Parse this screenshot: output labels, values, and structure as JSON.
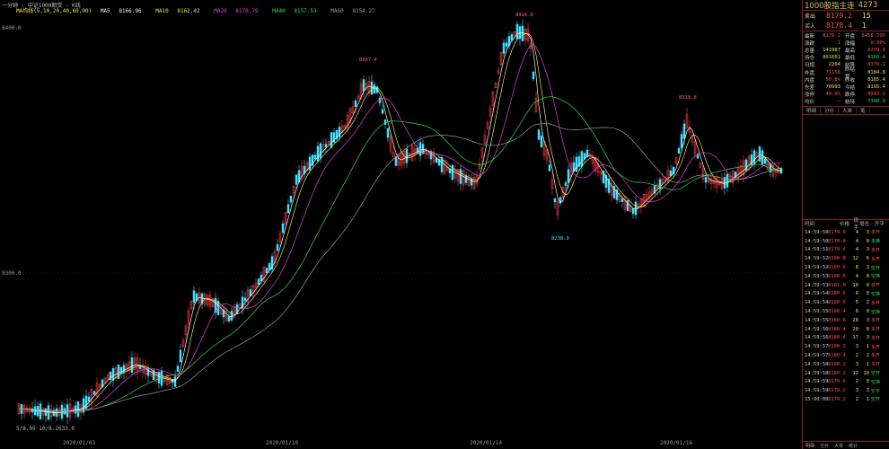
{
  "header": {
    "title": "一分钟 - 中证1000期货 - K线",
    "ma_label": "MA均线(5,10,20,40,60,90)",
    "ma": [
      {
        "label": "MA5",
        "value": "8166.96",
        "color": "#f0f0f0"
      },
      {
        "label": "MA10",
        "value": "8162.42",
        "color": "#e8e05a"
      },
      {
        "label": "MA20",
        "value": "8170.79",
        "color": "#e040e0"
      },
      {
        "label": "MA40",
        "value": "8157.53",
        "color": "#2adf4a"
      },
      {
        "label": "MA60",
        "value": "8154.27",
        "color": "#9a9a9a"
      }
    ]
  },
  "axis": {
    "y_ticks": [
      {
        "label": "8400.0"
      },
      {
        "label": "8300.0"
      }
    ],
    "x_ticks": [
      {
        "label": "2020/01/03"
      },
      {
        "label": "2020/01/10"
      },
      {
        "label": "2020/01/14"
      },
      {
        "label": "2020/01/16"
      }
    ],
    "bottom_left": "5/8.95 10/8.2633.0"
  },
  "markers": [
    {
      "label": "8367.4",
      "kind": "hi"
    },
    {
      "label": "8416.8",
      "kind": "hi"
    },
    {
      "label": "8238.0",
      "kind": "lo"
    },
    {
      "label": "8318.8",
      "kind": "hi"
    }
  ],
  "panel": {
    "title": "1000股指主连",
    "code": "4273",
    "ask": {
      "label": "卖出",
      "price": "8179.2",
      "vol": "15"
    },
    "bid": {
      "label": "买入",
      "price": "8178.4",
      "vol": "1"
    },
    "quote_rows": [
      {
        "k": "最新",
        "v": "8179.2",
        "vc": "#ff4a4a",
        "k2": "开盘",
        "v2": "8458.795",
        "v2c": "#ff4a4a"
      },
      {
        "k": "涨跌",
        "v": "1",
        "vc": "#ff4a4a",
        "k2": "涨幅",
        "v2": "0.00%",
        "v2c": "#ff4a4a"
      },
      {
        "k": "总量",
        "v": "141987",
        "vc": "#e8e05a",
        "k2": "最高",
        "v2": "8299.8",
        "v2c": "#ff4a4a"
      },
      {
        "k": "持仓",
        "v": "801661",
        "vc": "#e8e05a",
        "k2": "最低",
        "v2": "8166.4",
        "v2c": "#2adf4a"
      },
      {
        "k": "日增",
        "v": "2264",
        "vc": "#e8e05a",
        "k2": "结算",
        "v2": "8176.1",
        "v2c": "#ff4a4a"
      },
      {
        "k": "外盘",
        "v": "71156",
        "vc": "#ff4a4a",
        "k2": "昨结算",
        "v2": "8184.8",
        "v2c": "#e8e05a"
      },
      {
        "k": "内盘",
        "v": "50.8%",
        "vc": "#ff4a4a",
        "k2": "昨收",
        "v2": "8185.4",
        "v2c": "#e8e05a"
      },
      {
        "k": "仓差",
        "v": "70993",
        "vc": "#e8e05a",
        "k2": "今结",
        "v2": "8195.4",
        "v2c": "#e8e05a"
      },
      {
        "k": "涨停",
        "v": "49.8%",
        "vc": "#ff4a4a",
        "k2": "跌停",
        "v2": "8943.2",
        "v2c": "#ff4a4a"
      },
      {
        "k": "均价",
        "v": "—",
        "vc": "#9a9a9a",
        "k2": "结持",
        "v2": "7348.9",
        "v2c": "#2adf4a"
      }
    ],
    "tabs_top": [
      "明细",
      "分价",
      "大单",
      "笔"
    ],
    "tick_header": [
      "时间",
      "价格",
      "现手",
      "增仓",
      "开平"
    ],
    "ticks": [
      {
        "t": "14:59:50",
        "p": "8179.0",
        "c": "4",
        "n": "3",
        "s": "多开",
        "g": false
      },
      {
        "t": "14:59:50",
        "p": "8179.8",
        "c": "4",
        "n": "0",
        "s": "多换",
        "g": true
      },
      {
        "t": "14:59:51",
        "p": "8179.4",
        "c": "4",
        "n": "3",
        "s": "多开",
        "g": false
      },
      {
        "t": "14:59:52",
        "p": "8180.8",
        "c": "12",
        "n": "6",
        "s": "多开",
        "g": false
      },
      {
        "t": "14:59:52",
        "p": "8180.6",
        "c": "8",
        "n": "3",
        "s": "空开",
        "g": true
      },
      {
        "t": "14:59:53",
        "p": "8180.6",
        "c": "4",
        "n": "0",
        "s": "空换",
        "g": true
      },
      {
        "t": "14:59:53",
        "p": "8181.0",
        "c": "10",
        "n": "8",
        "s": "多开",
        "g": false
      },
      {
        "t": "14:59:54",
        "p": "8180.6",
        "c": "6",
        "n": "0",
        "s": "空换",
        "g": true
      },
      {
        "t": "14:59:54",
        "p": "8180.6",
        "c": "5",
        "n": "2",
        "s": "多开",
        "g": false
      },
      {
        "t": "14:59:55",
        "p": "8180.4",
        "c": "6",
        "n": "0",
        "s": "空换",
        "g": true
      },
      {
        "t": "14:59:55",
        "p": "8180.6",
        "c": "28",
        "n": "3",
        "s": "多开",
        "g": false
      },
      {
        "t": "14:59:56",
        "p": "8180.4",
        "c": "20",
        "n": "8",
        "s": "多开",
        "g": false
      },
      {
        "t": "14:59:56",
        "p": "8180.4",
        "c": "17",
        "n": "3",
        "s": "多开",
        "g": false
      },
      {
        "t": "14:59:57",
        "p": "8180.2",
        "c": "3",
        "n": "1",
        "s": "多开",
        "g": false
      },
      {
        "t": "14:59:57",
        "p": "8180.4",
        "c": "2",
        "n": "2",
        "s": "多开",
        "g": false
      },
      {
        "t": "14:59:58",
        "p": "8180.2",
        "c": "3",
        "n": "1",
        "s": "多开",
        "g": false
      },
      {
        "t": "14:59:58",
        "p": "8180.2",
        "c": "12",
        "n": "10",
        "s": "空开",
        "g": true
      },
      {
        "t": "14:59:59",
        "p": "8179.6",
        "c": "2",
        "n": "0",
        "s": "空换",
        "g": true
      },
      {
        "t": "14:59:59",
        "p": "8179.2",
        "c": "3",
        "n": "3",
        "s": "空平",
        "g": true
      },
      {
        "t": "15:00:00",
        "p": "8179.2",
        "c": "2",
        "n": "1",
        "s": "空开",
        "g": true
      }
    ],
    "footer": [
      "明细",
      "分价",
      "大单",
      "统计"
    ]
  }
}
